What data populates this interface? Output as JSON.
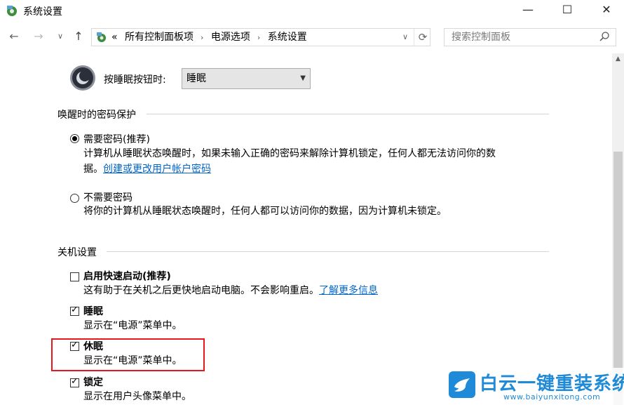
{
  "window": {
    "title": "系统设置",
    "min_glyph": "—",
    "max_glyph": "☐",
    "close_glyph": "✕"
  },
  "nav": {
    "back_glyph": "←",
    "forward_glyph": "→",
    "recent_glyph": "∨",
    "up_glyph": "↑"
  },
  "address": {
    "prefix": "«",
    "crumbs": [
      "所有控制面板项",
      "电源选项",
      "系统设置"
    ],
    "separator": "›",
    "dropdown_glyph": "∨",
    "refresh_glyph": "⟳"
  },
  "search": {
    "placeholder": "搜索控制面板"
  },
  "sleep_button": {
    "label": "按睡眠按钮时:",
    "selected": "睡眠"
  },
  "wake_password": {
    "title": "唤醒时的密码保护",
    "options": [
      {
        "label": "需要密码(推荐)",
        "checked": true,
        "desc_line1": "计算机从睡眠状态唤醒时，如果未输入正确的密码来解除计算机锁定，任何人都无法访问你的数",
        "desc_line2_prefix": "据。",
        "link": "创建或更改用户帐户密码"
      },
      {
        "label": "不需要密码",
        "checked": false,
        "desc_line1": "将你的计算机从睡眠状态唤醒时，任何人都可以访问你的数据，因为计算机未锁定。"
      }
    ]
  },
  "shutdown": {
    "title": "关机设置",
    "items": [
      {
        "label": "启用快速启动(推荐)",
        "checked": false,
        "desc": "这有助于在关机之后更快地启动电脑。不会影响重启。",
        "link": "了解更多信息"
      },
      {
        "label": "睡眠",
        "checked": true,
        "desc": "显示在“电源”菜单中。"
      },
      {
        "label": "休眠",
        "checked": true,
        "desc": "显示在“电源”菜单中。"
      },
      {
        "label": "锁定",
        "checked": true,
        "desc": "显示在用户头像菜单中。"
      }
    ]
  },
  "watermark": {
    "title": "白云一键重装系统",
    "url": "www.baiyunxitong.com"
  },
  "colors": {
    "link": "#0066cc",
    "highlight_box": "#e8171c",
    "watermark": "#1f8ad8"
  }
}
